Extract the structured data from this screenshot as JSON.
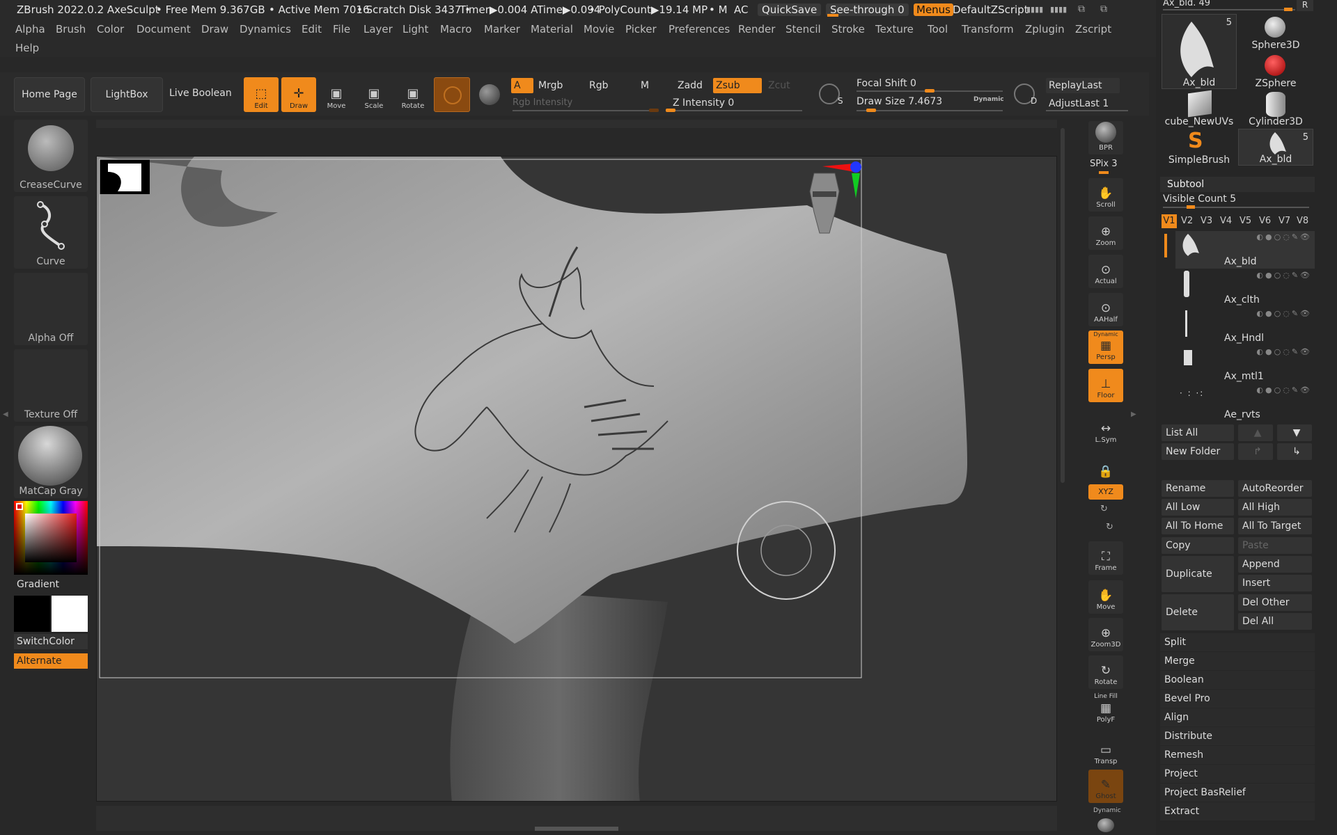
{
  "titlebar": {
    "app": "ZBrush 2022.0.2 AxeSculpt",
    "free_mem": "• Free Mem 9.367GB",
    "active_mem": "• Active Mem 7016",
    "scratch": "• Scratch Disk 3437 •",
    "timer": "Timer▶0.004 ATime▶0.094",
    "polycount": "• PolyCount▶19.14 MP",
    "m": "• M",
    "ac": "AC",
    "quicksave": "QuickSave",
    "see_through": "See-through  0",
    "menus": "Menus",
    "default_zscript": "DefaultZScript"
  },
  "menus": [
    "Alpha",
    "Brush",
    "Color",
    "Document",
    "Draw",
    "Dynamics",
    "Edit",
    "File",
    "Layer",
    "Light",
    "Macro",
    "Marker",
    "Material",
    "Movie",
    "Picker",
    "Preferences",
    "Render",
    "Stencil",
    "Stroke",
    "Texture",
    "Tool",
    "Transform",
    "Zplugin",
    "Zscript",
    "Help"
  ],
  "toolbar": {
    "home_page": "Home Page",
    "lightbox": "LightBox",
    "live_boolean": "Live Boolean",
    "edit": "Edit",
    "draw": "Draw",
    "move": "Move",
    "scale": "Scale",
    "rotate": "Rotate",
    "a": "A",
    "mrgb": "Mrgb",
    "rgb": "Rgb",
    "m": "M",
    "zadd": "Zadd",
    "zsub": "Zsub",
    "zcut": "Zcut",
    "rgb_intensity": "Rgb Intensity",
    "z_intensity": "Z Intensity 0",
    "focal_shift": "Focal Shift 0",
    "draw_size": "Draw Size 7.4673",
    "dynamic": "Dynamic",
    "s": "S",
    "d": "D",
    "replay_last": "ReplayLast",
    "adjust_last": "AdjustLast 1"
  },
  "left_shelf": {
    "crease_curve": "CreaseCurve",
    "curve": "Curve",
    "alpha_off": "Alpha Off",
    "texture_off": "Texture Off",
    "matcap": "MatCap Gray",
    "gradient": "Gradient",
    "switch_color": "SwitchColor",
    "alternate": "Alternate"
  },
  "right_toolbar": {
    "bpr": "BPR",
    "spix": "SPix 3",
    "scroll": "Scroll",
    "zoom": "Zoom",
    "actual": "Actual",
    "aahalf": "AAHalf",
    "dynamic_label": "Dynamic",
    "persp": "Persp",
    "floor": "Floor",
    "lsym": "L.Sym",
    "xyz": "XYZ",
    "frame": "Frame",
    "move": "Move",
    "zoom3d": "Zoom3D",
    "rotate": "Rotate",
    "line_fill": "Line Fill",
    "polyf": "PolyF",
    "transp": "Transp",
    "ghost": "Ghost",
    "dynamic2": "Dynamic"
  },
  "tool_palette": {
    "ax_bld_slider": "Ax_bld. 49",
    "r": "R",
    "thumbs": [
      {
        "label": "Ax_bld",
        "count": "5"
      },
      {
        "label": "Sphere3D",
        "count": ""
      },
      {
        "label": "ZSphere",
        "count": ""
      },
      {
        "label": "cube_NewUVs",
        "count": ""
      },
      {
        "label": "Cylinder3D",
        "count": ""
      },
      {
        "label": "SimpleBrush",
        "count": ""
      },
      {
        "label": "Ax_bld",
        "count": "5"
      }
    ]
  },
  "subtool": {
    "title": "Subtool",
    "visible_count": "Visible Count 5",
    "versions": [
      "V1",
      "V2",
      "V3",
      "V4",
      "V5",
      "V6",
      "V7",
      "V8"
    ],
    "items": [
      "Ax_bld",
      "Ax_clth",
      "Ax_Hndl",
      "Ax_mtl1",
      "Ae_rvts"
    ],
    "list_all": "List All",
    "new_folder": "New Folder",
    "rename": "Rename",
    "auto_reorder": "AutoReorder",
    "all_low": "All Low",
    "all_high": "All High",
    "all_to_home": "All To Home",
    "all_to_target": "All To Target",
    "copy": "Copy",
    "paste": "Paste",
    "duplicate": "Duplicate",
    "append": "Append",
    "insert": "Insert",
    "delete": "Delete",
    "del_other": "Del Other",
    "del_all": "Del All",
    "rows": [
      "Split",
      "Merge",
      "Boolean",
      "Bevel Pro",
      "Align",
      "Distribute",
      "Remesh",
      "Project",
      "Project BasRelief",
      "Extract"
    ]
  },
  "colors": {
    "accent": "#f08a1c",
    "panel": "#2b2b2b",
    "viewport": "#353535"
  }
}
